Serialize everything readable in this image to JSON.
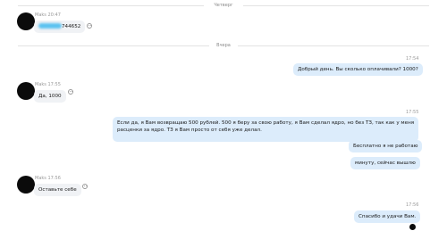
{
  "dividers": {
    "first": "Четверг",
    "second": "Вчера"
  },
  "messages": {
    "m1": {
      "sender": "Maks",
      "time": "20:47",
      "prefix": "",
      "visible_text": "744652"
    },
    "m2": {
      "time": "17:54",
      "text": "Добрый день. Вы сколько оплачивали? 1000?"
    },
    "m3": {
      "sender": "Maks",
      "time": "17:55",
      "text": "Да, 1000"
    },
    "m4": {
      "time": "17:55",
      "line1": "Если да, я Вам возвращаю 500 рублей. 500 я беру за свою работу, я Вам сделал ядро, но без ТЗ, так как у меня",
      "line2": "расценки за ядро. ТЗ я Вам просто от себя уже делал."
    },
    "m5": {
      "text": "Бесплатно я не работаю"
    },
    "m6": {
      "text": "минуту, сейчас вышлю"
    },
    "m7": {
      "sender": "Maks",
      "time": "17:56",
      "text": "Оставьте себе"
    },
    "m8": {
      "time": "17:56",
      "text": "Спасибо и удачи Вам."
    }
  },
  "colors": {
    "incoming_bubble": "#f0f2f5",
    "outgoing_bubble": "#dcecfb",
    "redaction": "#5bc2f0"
  }
}
